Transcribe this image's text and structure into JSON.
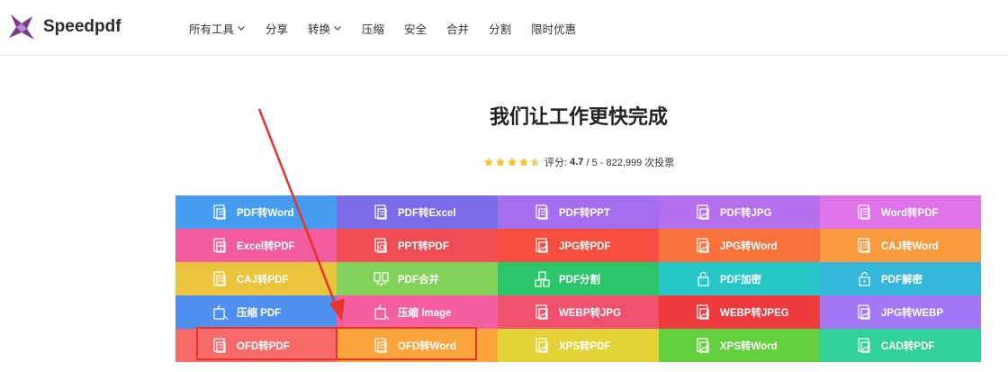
{
  "header": {
    "brand": "Speedpdf",
    "nav": [
      {
        "label": "所有工具",
        "has_dropdown": true
      },
      {
        "label": "分享",
        "has_dropdown": false
      },
      {
        "label": "转换",
        "has_dropdown": true
      },
      {
        "label": "压缩",
        "has_dropdown": false
      },
      {
        "label": "安全",
        "has_dropdown": false
      },
      {
        "label": "合并",
        "has_dropdown": false
      },
      {
        "label": "分割",
        "has_dropdown": false
      },
      {
        "label": "限时优惠",
        "has_dropdown": false
      }
    ]
  },
  "hero": {
    "title": "我们让工作更快完成"
  },
  "rating": {
    "stars_filled": 4.5,
    "stars_total": 5,
    "label": "评分:",
    "score": "4.7",
    "rest": "/ 5 - 822,999 次投票"
  },
  "tools": [
    {
      "label": "PDF转Word",
      "color": "#469cf0",
      "icon": "file-convert-icon"
    },
    {
      "label": "PDF转Excel",
      "color": "#7a6be9",
      "icon": "file-convert-icon"
    },
    {
      "label": "PDF转PPT",
      "color": "#a46eef",
      "icon": "file-convert-icon"
    },
    {
      "label": "PDF转JPG",
      "color": "#b470ed",
      "icon": "image-file-icon"
    },
    {
      "label": "Word转PDF",
      "color": "#df73e9",
      "icon": "file-convert-icon"
    },
    {
      "label": "Excel转PDF",
      "color": "#f25b9e",
      "icon": "table-file-icon"
    },
    {
      "label": "PPT转PDF",
      "color": "#ee4c55",
      "icon": "slides-file-icon"
    },
    {
      "label": "JPG转PDF",
      "color": "#f64e41",
      "icon": "image-file-icon"
    },
    {
      "label": "JPG转Word",
      "color": "#f9723e",
      "icon": "image-file-icon"
    },
    {
      "label": "CAJ转Word",
      "color": "#fa9a3f",
      "icon": "file-convert-icon"
    },
    {
      "label": "CAJ转PDF",
      "color": "#e9c43c",
      "icon": "file-convert-icon"
    },
    {
      "label": "PDF合并",
      "color": "#82d15a",
      "icon": "merge-icon"
    },
    {
      "label": "PDF分割",
      "color": "#2cc56b",
      "icon": "split-icon"
    },
    {
      "label": "PDF加密",
      "color": "#27c7c8",
      "icon": "lock-icon"
    },
    {
      "label": "PDF解密",
      "color": "#35b6db",
      "icon": "unlock-icon"
    },
    {
      "label": "压缩 PDF",
      "color": "#4f8ff0",
      "icon": "compress-icon"
    },
    {
      "label": "压缩 Image",
      "color": "#f35fa1",
      "icon": "compress-icon"
    },
    {
      "label": "WEBP转JPG",
      "color": "#f0526e",
      "icon": "image-file-icon"
    },
    {
      "label": "WEBP转JPEG",
      "color": "#ee3a3d",
      "icon": "image-file-icon"
    },
    {
      "label": "JPG转WEBP",
      "color": "#a377f5",
      "icon": "image-file-icon"
    },
    {
      "label": "OFD转PDF",
      "color": "#f66a69",
      "icon": "file-convert-icon"
    },
    {
      "label": "OFD转Word",
      "color": "#fba43b",
      "icon": "file-convert-icon"
    },
    {
      "label": "XPS转PDF",
      "color": "#e3d136",
      "icon": "image-file-icon"
    },
    {
      "label": "XPS转Word",
      "color": "#64cf3f",
      "icon": "image-file-icon"
    },
    {
      "label": "CAD转PDF",
      "color": "#31d09b",
      "icon": "image-file-icon"
    }
  ],
  "annotation": {
    "color": "#e8342b"
  }
}
